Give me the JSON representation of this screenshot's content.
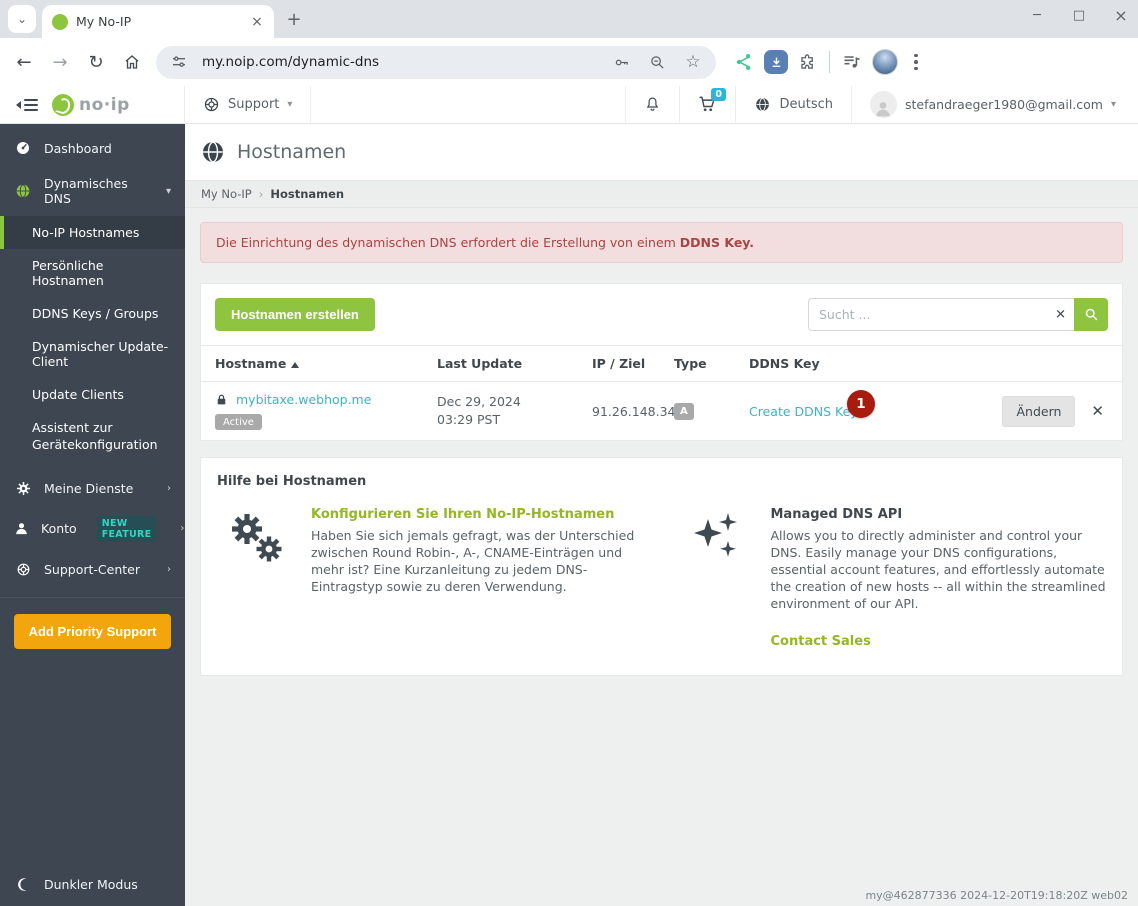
{
  "browser": {
    "tab_title": "My No-IP",
    "url": "my.noip.com/dynamic-dns"
  },
  "navbar": {
    "logo_text": "no·ip",
    "support_label": "Support",
    "cart_badge": "0",
    "language": "Deutsch",
    "user_email": "stefandraeger1980@gmail.com"
  },
  "sidebar": {
    "dashboard": "Dashboard",
    "dynamic_dns": "Dynamisches DNS",
    "submenu": [
      "No-IP Hostnames",
      "Persönliche Hostnamen",
      "DDNS Keys / Groups",
      "Dynamischer Update-Client",
      "Update Clients",
      "Assistent zur Gerätekonfiguration"
    ],
    "meine_dienste": "Meine Dienste",
    "konto": "Konto",
    "new_feature": "NEW FEATURE",
    "support_center": "Support-Center",
    "add_priority": "Add Priority Support",
    "dark_mode": "Dunkler Modus"
  },
  "page": {
    "title": "Hostnamen",
    "breadcrumb_root": "My No-IP",
    "breadcrumb_sep": "›",
    "breadcrumb_current": "Hostnamen",
    "alert_text": "Die Einrichtung des dynamischen DNS erfordert die Erstellung von einem",
    "alert_bold": "DDNS Key.",
    "create_button": "Hostnamen erstellen",
    "search_placeholder": "Sucht ..."
  },
  "table": {
    "headers": [
      "Hostname",
      "Last Update",
      "IP / Ziel",
      "Type",
      "DDNS Key"
    ],
    "row": {
      "hostname": "mybitaxe.webhop.me",
      "status": "Active",
      "last_update_date": "Dec 29, 2024",
      "last_update_time": "03:29 PST",
      "ip": "91.26.148.34",
      "type": "A",
      "ddns_key_link": "Create DDNS Key",
      "annotation": "1",
      "edit_button": "Ändern"
    }
  },
  "help": {
    "title": "Hilfe bei Hostnamen",
    "left": {
      "link": "Konfigurieren Sie Ihren No-IP-Hostnamen",
      "body": "Haben Sie sich jemals gefragt, was der Unterschied zwischen Round Robin-, A-, CNAME-Einträgen und mehr ist? Eine Kurzanleitung zu jedem DNS-Eintragstyp sowie zu deren Verwendung."
    },
    "right": {
      "title": "Managed DNS API",
      "body": "Allows you to directly administer and control your DNS. Easily manage your DNS configurations, essential account features, and effortlessly automate the creation of new hosts -- all within the streamlined environment of our API.",
      "link": "Contact Sales"
    }
  },
  "footer": {
    "text": "my@462877336 2024-12-20T19:18:20Z web02"
  },
  "colors": {
    "accent_green": "#8cc63f",
    "sidebar_bg": "#3d4651",
    "link_teal": "#3fb2c4",
    "alert_bg": "#f2dede",
    "alert_text": "#a94442",
    "annotation_red": "#a81c0f",
    "priority_orange": "#f2a50c",
    "new_feature_teal": "#2fd6c0",
    "cart_badge_blue": "#29b6d8"
  }
}
